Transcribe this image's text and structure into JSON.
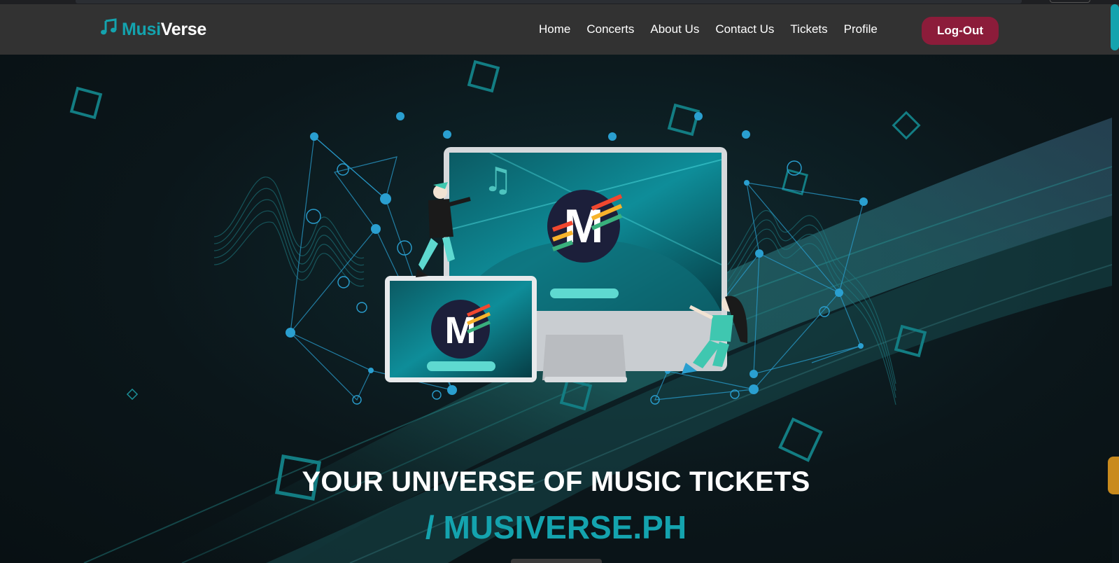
{
  "brand": {
    "part1": "Musi",
    "part2": "Verse",
    "icon": "music-note-icon"
  },
  "nav": {
    "items": [
      {
        "label": "Home"
      },
      {
        "label": "Concerts"
      },
      {
        "label": "About Us"
      },
      {
        "label": "Contact Us"
      },
      {
        "label": "Tickets"
      },
      {
        "label": "Profile"
      }
    ],
    "logout_label": "Log-Out"
  },
  "hero": {
    "headline": "YOUR UNIVERSE OF MUSIC TICKETS",
    "subline": "/ MUSIVERSE.PH",
    "logo_mark": "M"
  },
  "colors": {
    "accent": "#14a3ae",
    "navbar": "#323232",
    "logout": "#8c1c3a",
    "background": "#0b161a"
  }
}
